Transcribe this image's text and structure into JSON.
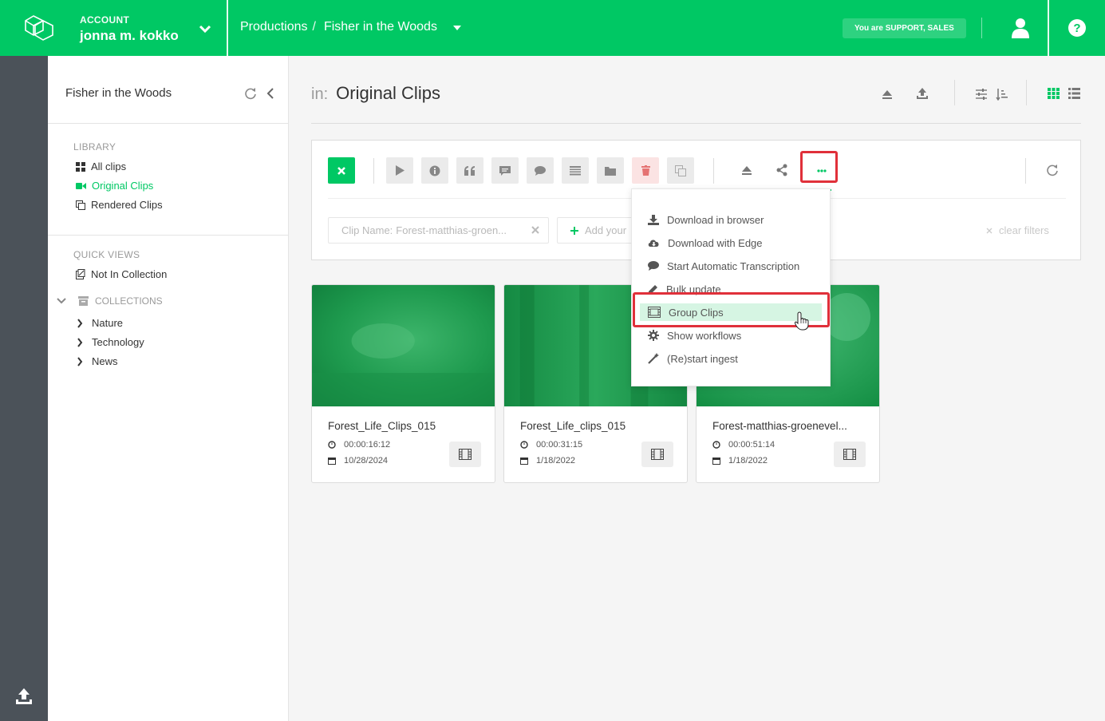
{
  "header": {
    "account_label": "ACCOUNT",
    "account_name": "jonna m. kokko",
    "breadcrumb_root": "Productions",
    "breadcrumb_sep": "/",
    "breadcrumb_current": "Fisher in the Woods",
    "role_badge": "You are SUPPORT, SALES",
    "icons": [
      "logo-icon",
      "chevron-down-icon",
      "caret-down-icon",
      "user-icon",
      "help-icon"
    ],
    "accent_color": "#00c864"
  },
  "sidebar": {
    "title": "Fisher in the Woods",
    "library_label": "LIBRARY",
    "library_items": [
      {
        "label": "All clips",
        "icon": "grid-icon",
        "active": false
      },
      {
        "label": "Original Clips",
        "icon": "video-camera-icon",
        "active": true
      },
      {
        "label": "Rendered Clips",
        "icon": "copy-icon",
        "active": false
      }
    ],
    "quick_views_label": "QUICK VIEWS",
    "quick_views_items": [
      {
        "label": "Not In Collection",
        "icon": "not-in-collection-icon"
      }
    ],
    "collections_label": "COLLECTIONS",
    "collections_items": [
      {
        "label": "Nature"
      },
      {
        "label": "Technology"
      },
      {
        "label": "News"
      }
    ]
  },
  "main": {
    "in_label": "in:",
    "title": "Original Clips",
    "filters": {
      "chip_label": "Clip Name:",
      "chip_value": "Forest-matthias-groen...",
      "add_filter_label": "Add your",
      "clear_label": "clear filters"
    },
    "toolbar_icons": [
      "close-icon",
      "play-icon",
      "info-icon",
      "quote-icon",
      "comment-icon",
      "comments-icon",
      "list-icon",
      "folder-icon",
      "trash-icon",
      "copy-icon",
      "eject-icon",
      "share-icon",
      "more-icon",
      "refresh-icon"
    ],
    "cards": [
      {
        "name": "Forest_Life_Clips_015",
        "duration": "00:00:16:12",
        "date": "10/28/2024"
      },
      {
        "name": "Forest_Life_clips_015",
        "duration": "00:00:31:15",
        "date": "1/18/2022"
      },
      {
        "name": "Forest-matthias-groenevel...",
        "duration": "00:00:51:14",
        "date": "1/18/2022"
      }
    ]
  },
  "menu": {
    "items": [
      {
        "label": "Download in browser",
        "icon": "download-icon"
      },
      {
        "label": "Download with Edge",
        "icon": "cloud-download-icon"
      },
      {
        "label": "Start Automatic Transcription",
        "icon": "comment-icon"
      },
      {
        "label": "Bulk update",
        "icon": "pencil-icon"
      },
      {
        "label": "Group Clips",
        "icon": "group-clips-icon",
        "highlighted": true
      },
      {
        "label": "Show workflows",
        "icon": "gear-icon"
      },
      {
        "label": "(Re)start ingest",
        "icon": "magic-wand-icon"
      }
    ]
  }
}
